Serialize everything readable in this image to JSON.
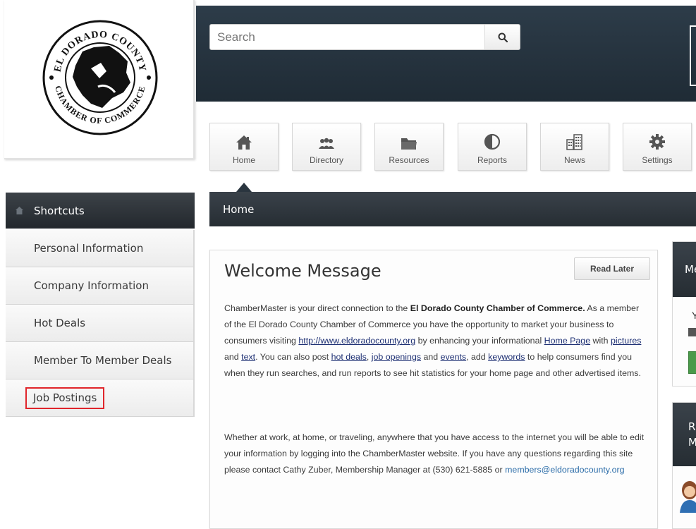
{
  "logo": {
    "alt": "El Dorado County Chamber of Commerce",
    "text_top": "EL DORADO COUNTY",
    "text_bottom": "CHAMBER OF COMMERCE"
  },
  "search": {
    "placeholder": "Search",
    "value": ""
  },
  "nav_tiles": [
    {
      "label": "Home",
      "icon": "home-icon"
    },
    {
      "label": "Directory",
      "icon": "people-icon"
    },
    {
      "label": "Resources",
      "icon": "folder-icon"
    },
    {
      "label": "Reports",
      "icon": "reports-icon"
    },
    {
      "label": "News",
      "icon": "news-icon"
    },
    {
      "label": "Settings",
      "icon": "gear-icon"
    }
  ],
  "breadcrumb": {
    "current": "Home"
  },
  "sidebar": {
    "header": "Shortcuts",
    "items": [
      {
        "label": "Personal Information"
      },
      {
        "label": "Company Information"
      },
      {
        "label": "Hot Deals"
      },
      {
        "label": "Member To Member Deals"
      },
      {
        "label": "Job Postings"
      }
    ]
  },
  "welcome": {
    "title": "Welcome Message",
    "read_later": "Read Later",
    "p1": {
      "t1": "ChamberMaster is your direct connection to the ",
      "b1": "El Dorado County Chamber of Commerce.",
      "t2": " As a member of the El Dorado County Chamber of Commerce you have the opportunity to market your business to consumers visiting ",
      "l1": "http://www.eldoradocounty.org",
      "t3": " by enhancing your informational ",
      "l2": "Home Page",
      "t4": " with ",
      "l3": "pictures",
      "t5": " and ",
      "l4": "text",
      "t6": ". You can also post ",
      "l5": "hot deals",
      "t7": ", ",
      "l6": "job openings",
      "t8": " and ",
      "l7": "events",
      "t9": ", add ",
      "l8": "keywords",
      "t10": " to help consumers find you when they run searches, and run reports to see hit statistics for your home page and other advertised items."
    },
    "p2": {
      "t1": "Whether at work, at home, or traveling, anywhere that you have access to the internet you will be able to edit your information by logging into the ChamberMaster website. If you have any questions regarding this site please contact Cathy Zuber, Membership Manager at (530) 621-5885 or ",
      "email": "members@eldoradocounty.org"
    }
  },
  "side_cards": [
    {
      "title": "Me",
      "body": "Y"
    },
    {
      "title": "R",
      "title2": "M"
    }
  ],
  "colors": {
    "header_dark": "#1f2b35",
    "bar_dark": "#262d33",
    "highlight_box": "#e0252b",
    "link": "#1d2f73",
    "green_button": "#4a9a4a"
  }
}
